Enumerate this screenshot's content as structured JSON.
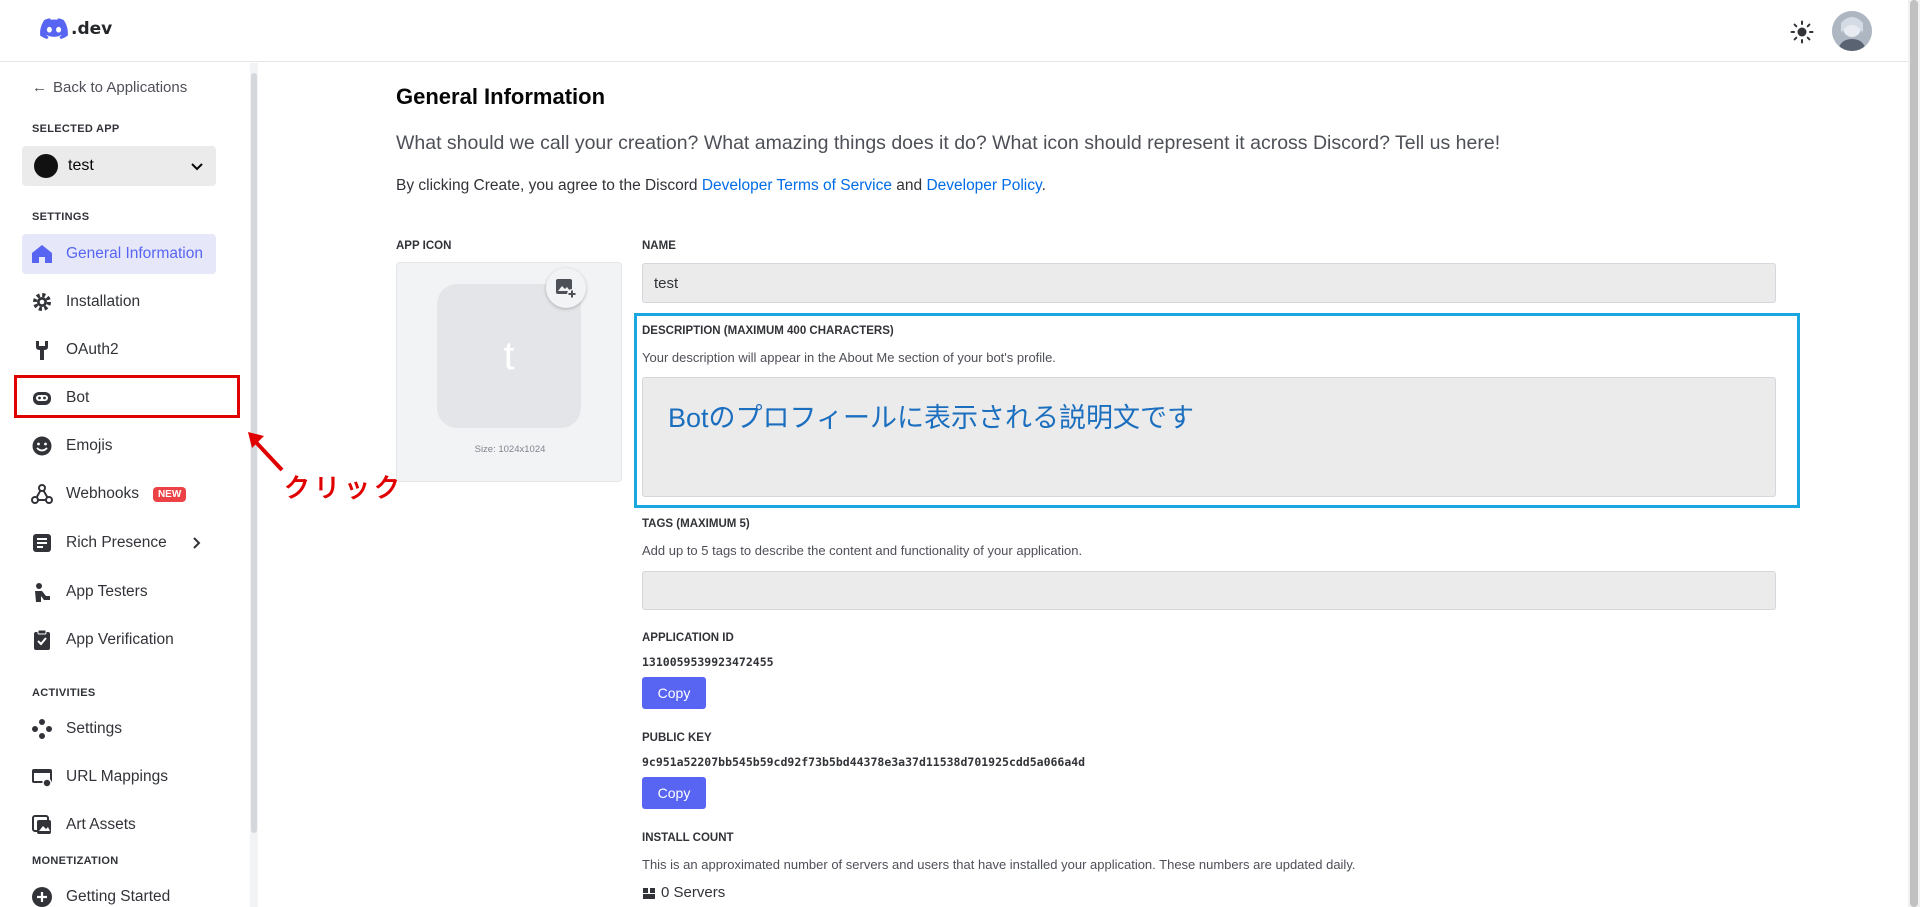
{
  "header": {
    "logo_text": ".dev",
    "theme_icon": "sun-icon",
    "avatar_icon": "user-avatar"
  },
  "sidebar": {
    "back_label": "Back to Applications",
    "selected_app_label": "SELECTED APP",
    "selected_app_name": "test",
    "settings_label": "SETTINGS",
    "activities_label": "ACTIVITIES",
    "monetization_label": "MONETIZATION",
    "items": [
      {
        "label": "General Information",
        "icon": "home-icon"
      },
      {
        "label": "Installation",
        "icon": "gear-icon"
      },
      {
        "label": "OAuth2",
        "icon": "wrench-icon"
      },
      {
        "label": "Bot",
        "icon": "robot-icon"
      },
      {
        "label": "Emojis",
        "icon": "emoji-icon"
      },
      {
        "label": "Webhooks",
        "icon": "webhook-icon",
        "badge": "NEW"
      },
      {
        "label": "Rich Presence",
        "icon": "list-icon"
      },
      {
        "label": "App Testers",
        "icon": "tester-icon"
      },
      {
        "label": "App Verification",
        "icon": "clipboard-check-icon"
      },
      {
        "label": "Settings",
        "icon": "gamepad-icon"
      },
      {
        "label": "URL Mappings",
        "icon": "url-icon"
      },
      {
        "label": "Art Assets",
        "icon": "image-icon"
      },
      {
        "label": "Getting Started",
        "icon": "plus-circle-icon"
      }
    ]
  },
  "annotation": {
    "text": "クリック",
    "color": "#e00000"
  },
  "main": {
    "title": "General Information",
    "subtitle": "What should we call your creation? What amazing things does it do? What icon should represent it across Discord? Tell us here!",
    "terms_prefix": "By clicking Create, you agree to the Discord ",
    "terms_link1": "Developer Terms of Service",
    "terms_and": " and ",
    "terms_link2": "Developer Policy",
    "terms_suffix": ".",
    "app_icon_label": "APP ICON",
    "app_icon_letter": "t",
    "app_icon_size": "Size: 1024x1024",
    "name_label": "NAME",
    "name_value": "test",
    "description_label": "DESCRIPTION (MAXIMUM 400 CHARACTERS)",
    "description_help": "Your description will appear in the About Me section of your bot's profile.",
    "description_value": "Botのプロフィールに表示される説明文です",
    "tags_label": "TAGS (MAXIMUM 5)",
    "tags_help": "Add up to 5 tags to describe the content and functionality of your application.",
    "app_id_label": "APPLICATION ID",
    "app_id_value": "1310059539923472455",
    "copy_label": "Copy",
    "public_key_label": "PUBLIC KEY",
    "public_key_value": "9c951a52207bb545b59cd92f73b5bd44378e3a37d11538d701925cdd5a066a4d",
    "install_count_label": "INSTALL COUNT",
    "install_count_help": "This is an approximated number of servers and users that have installed your application. These numbers are updated daily.",
    "servers_value": "0 Servers"
  },
  "colors": {
    "accent": "#5865f2",
    "link": "#006ce7",
    "highlight_red": "#e00000",
    "highlight_blue": "#1aa7e0"
  }
}
